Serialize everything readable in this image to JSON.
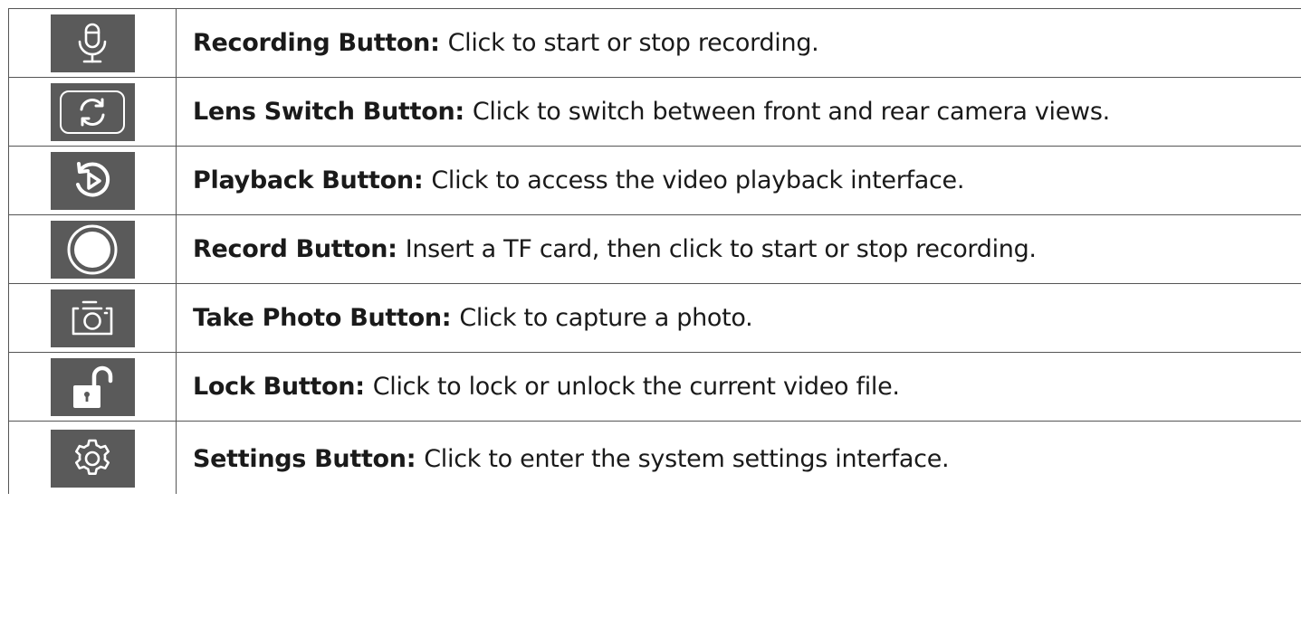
{
  "rows": [
    {
      "icon": "microphone-icon",
      "term": "Recording Button:",
      "desc": "Click to start or stop recording."
    },
    {
      "icon": "lens-switch-icon",
      "term": "Lens Switch Button:",
      "desc": "Click to switch between front and rear camera views."
    },
    {
      "icon": "playback-icon",
      "term": "Playback Button:",
      "desc": "Click to access the video playback interface."
    },
    {
      "icon": "record-icon",
      "term": "Record Button:",
      "desc": "Insert a TF card, then click to start or stop recording."
    },
    {
      "icon": "camera-icon",
      "term": "Take Photo Button:",
      "desc": "Click to capture a photo."
    },
    {
      "icon": "unlock-icon",
      "term": "Lock Button:",
      "desc": "Click to lock or unlock the current video file."
    },
    {
      "icon": "gear-icon",
      "term": "Settings Button:",
      "desc": "Click to enter the system settings interface."
    }
  ],
  "colors": {
    "icon_background": "#5a5a5a",
    "icon_foreground": "#ffffff",
    "border": "#555555"
  }
}
